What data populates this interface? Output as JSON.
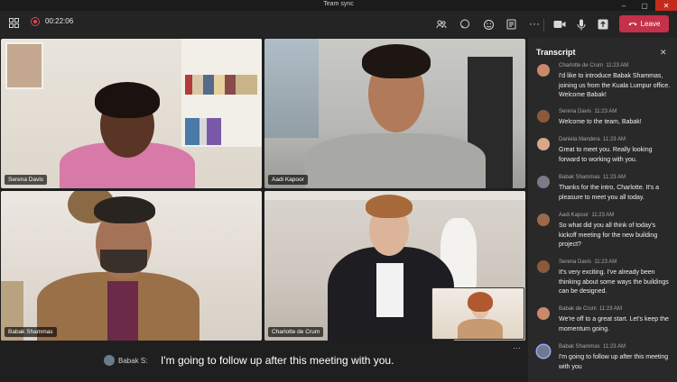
{
  "window": {
    "title": "Team sync"
  },
  "toolbar": {
    "timer": "00:22:06",
    "leave_label": "Leave"
  },
  "participants": [
    {
      "name": "Serena Davis"
    },
    {
      "name": "Aadi Kapoor"
    },
    {
      "name": "Babak Shammas"
    },
    {
      "name": "Charlotte de Crum"
    }
  ],
  "caption": {
    "speaker": "Babak S:",
    "text": "I'm going to follow up after this meeting with you."
  },
  "transcript": {
    "title": "Transcript",
    "entries": [
      {
        "speaker": "Charlotte de Crum",
        "time": "11:23 AM",
        "text": "I'd like to introduce Babak Shammas, joining us from the Kuala Lumpur office. Welcome Babak!"
      },
      {
        "speaker": "Serena Davis",
        "time": "11:23 AM",
        "text": "Welcome to the team, Babak!"
      },
      {
        "speaker": "Daniela Mandera",
        "time": "11:23 AM",
        "text": "Great to meet you. Really looking forward to working with you."
      },
      {
        "speaker": "Babak Shammas",
        "time": "11:23 AM",
        "text": "Thanks for the intro, Charlotte. It's a pleasure to meet you all today."
      },
      {
        "speaker": "Aadi Kapoor",
        "time": "11:23 AM",
        "text": "So what did you all think of today's kickoff meeting for the new building project?"
      },
      {
        "speaker": "Serena Davis",
        "time": "11:23 AM",
        "text": "It's very exciting. I've already been thinking about some ways the buildings can be designed."
      },
      {
        "speaker": "Babak de Crum",
        "time": "11:23 AM",
        "text": "We're off to a great start. Let's keep the momentum going."
      },
      {
        "speaker": "Babak Shammas",
        "time": "11:23 AM",
        "text": "I'm going to follow up after this meeting with you"
      }
    ]
  },
  "colors": {
    "leave": "#c4314b",
    "record": "#e0434f",
    "accent": "#9ea6ff"
  }
}
